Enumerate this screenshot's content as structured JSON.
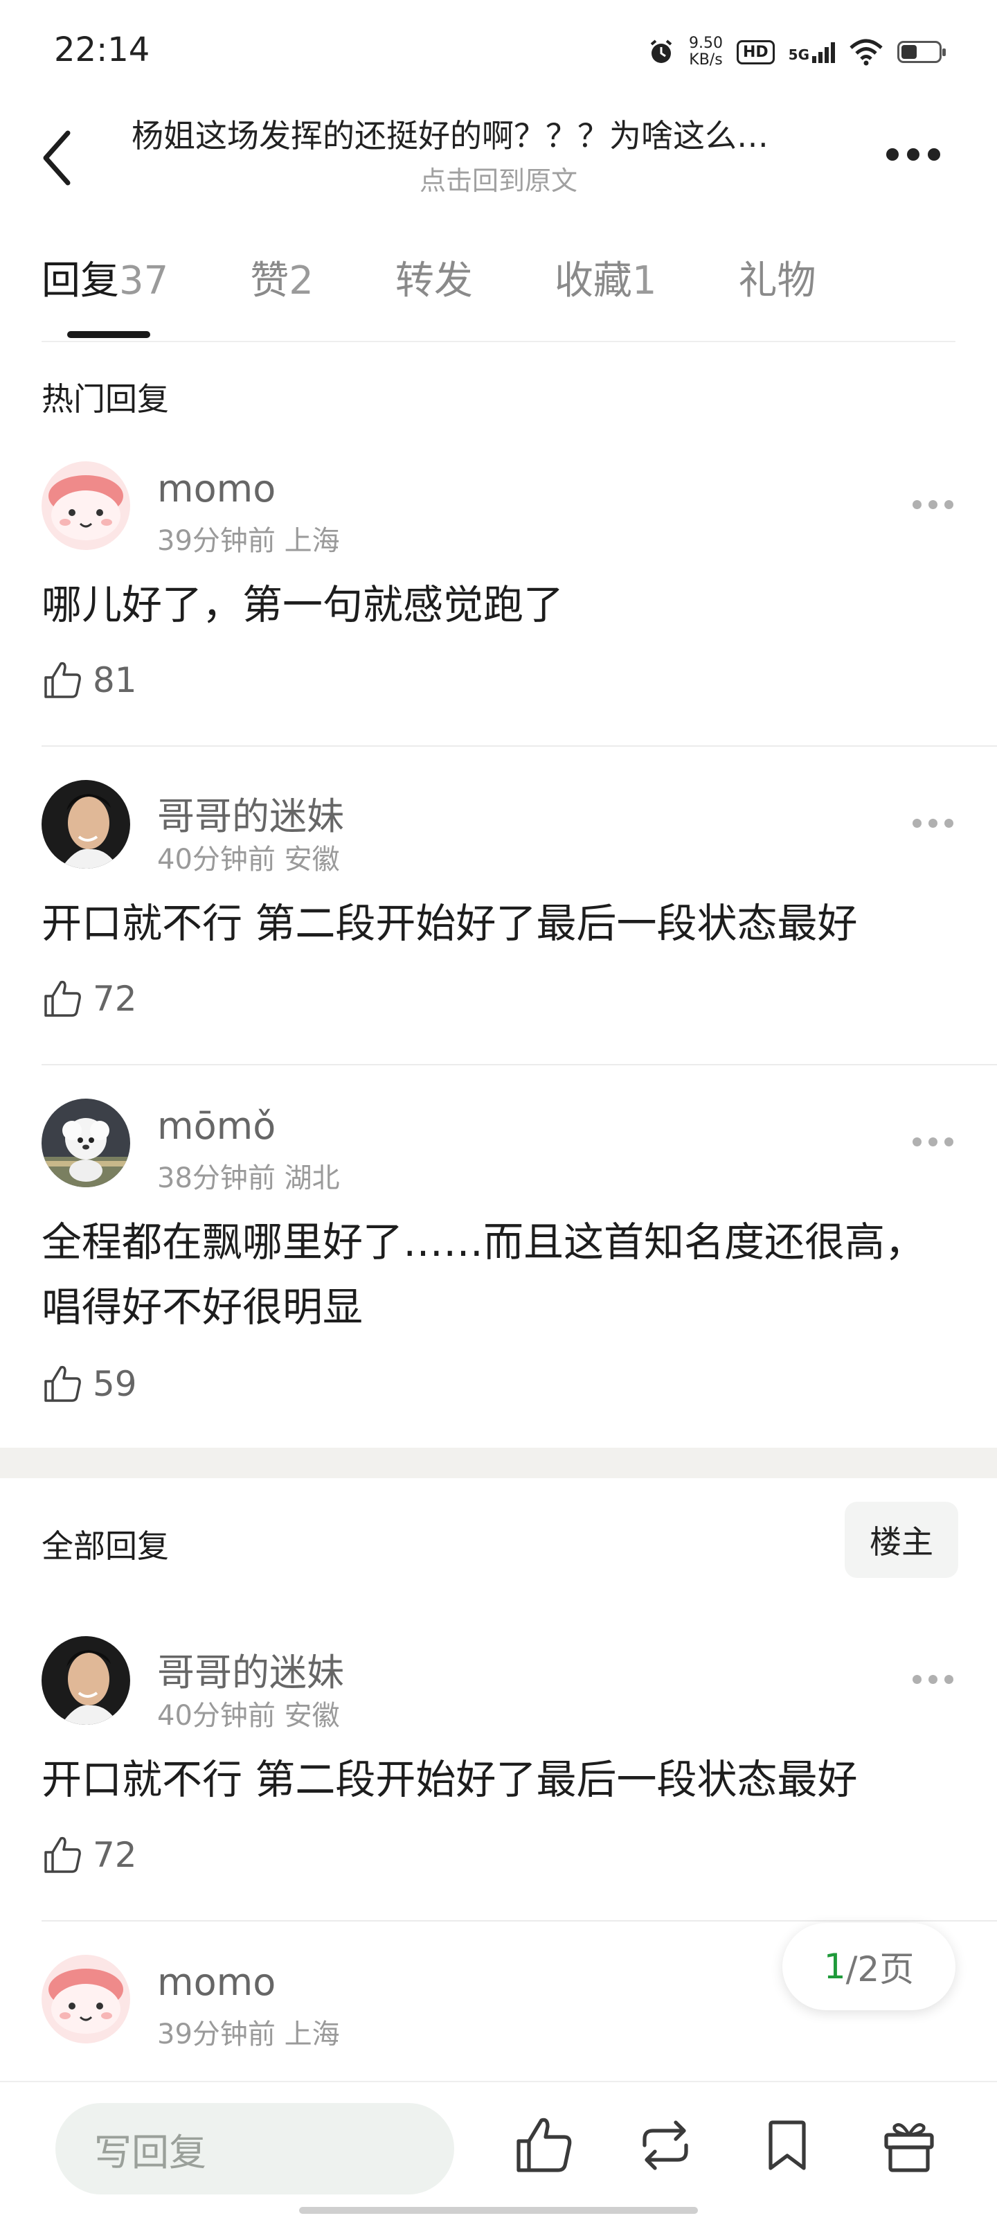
{
  "status_bar": {
    "time": "22:14",
    "net_speed_value": "9.50",
    "net_speed_unit": "KB/s",
    "hd_label": "HD",
    "network_label": "5G",
    "battery_level": 0.3,
    "icons": [
      "alarm-icon",
      "hd-icon",
      "signal-icon",
      "wifi-icon",
      "battery-icon"
    ]
  },
  "header": {
    "title": "杨姐这场发挥的还挺好的啊？？？为啥这么…",
    "subtitle": "点击回到原文"
  },
  "tabs": [
    {
      "label": "回复",
      "count": "37",
      "active": true
    },
    {
      "label": "赞",
      "count": "2",
      "active": false
    },
    {
      "label": "转发",
      "count": "",
      "active": false
    },
    {
      "label": "收藏",
      "count": "1",
      "active": false
    },
    {
      "label": "礼物",
      "count": "",
      "active": false
    }
  ],
  "hot_section": {
    "title": "热门回复",
    "comments": [
      {
        "username": "momo",
        "time": "39分钟前",
        "location": "上海",
        "text": "哪儿好了，第一句就感觉跑了",
        "likes": "81"
      },
      {
        "username": "哥哥的迷妹",
        "time": "40分钟前",
        "location": "安徽",
        "text": "开口就不行  第二段开始好了最后一段状态最好",
        "likes": "72"
      },
      {
        "username": "mōmǒ",
        "time": "38分钟前",
        "location": "湖北",
        "text": "全程都在飘哪里好了……而且这首知名度还很高，唱得好不好很明显",
        "likes": "59"
      }
    ]
  },
  "all_section": {
    "title": "全部回复",
    "owner_button": "楼主",
    "comments": [
      {
        "username": "哥哥的迷妹",
        "time": "40分钟前",
        "location": "安徽",
        "text": "开口就不行  第二段开始好了最后一段状态最好",
        "likes": "72"
      },
      {
        "username": "momo",
        "time": "39分钟前",
        "location": "上海",
        "text": "",
        "likes": ""
      }
    ]
  },
  "pager": {
    "current": "1",
    "total": "/2页"
  },
  "bottom_bar": {
    "reply_placeholder": "写回复",
    "icons": [
      "like-icon",
      "repost-icon",
      "bookmark-icon",
      "gift-icon"
    ]
  },
  "colors": {
    "accent_green": "#1f9a3a",
    "text_primary": "#1d1d1d",
    "text_secondary": "#9a9a9a"
  }
}
